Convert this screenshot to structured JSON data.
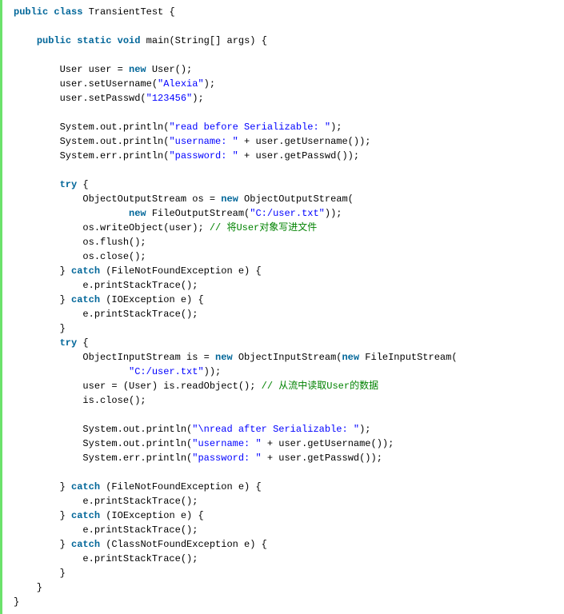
{
  "code": {
    "t01": "public",
    "t02": "class",
    "t03": " TransientTest {",
    "blank": "",
    "t04": "public",
    "t05": "static",
    "t06": "void",
    "t07": " main(String[] args) {",
    "t08": "        User user = ",
    "t09": "new",
    "t10": " User();",
    "t11": "        user.setUsername(",
    "t12": "\"Alexia\"",
    "t13": ");",
    "t14": "        user.setPasswd(",
    "t15": "\"123456\"",
    "t16": ");",
    "t17": "        System.out.println(",
    "t18": "\"read before Serializable: \"",
    "t19": ");",
    "t20": "        System.out.println(",
    "t21": "\"username: \"",
    "t22": " + user.getUsername());",
    "t23": "        System.err.println(",
    "t24": "\"password: \"",
    "t25": " + user.getPasswd());",
    "t26": "try",
    "t27": " {",
    "t28": "            ObjectOutputStream os = ",
    "t29": "new",
    "t30": " ObjectOutputStream(",
    "t31": "                    ",
    "t32": "new",
    "t33": " FileOutputStream(",
    "t34": "\"C:/user.txt\"",
    "t35": "));",
    "t36": "            os.writeObject(user); ",
    "t37": "// 将User对象写进文件",
    "t38": "            os.flush();",
    "t39": "            os.close();",
    "t40": "        } ",
    "t41": "catch",
    "t42": " (FileNotFoundException e) {",
    "t43": "            e.printStackTrace();",
    "t44": "        } ",
    "t45": "catch",
    "t46": " (IOException e) {",
    "t47": "            e.printStackTrace();",
    "t48": "        }",
    "t49": "try",
    "t50": " {",
    "t51": "            ObjectInputStream is = ",
    "t52": "new",
    "t53": " ObjectInputStream(",
    "t54": "new",
    "t55": " FileInputStream(",
    "t56": "                    ",
    "t57": "\"C:/user.txt\"",
    "t58": "));",
    "t59": "            user = (User) is.readObject(); ",
    "t60": "// 从流中读取User的数据",
    "t61": "            is.close();",
    "t62": "            System.out.println(",
    "t63": "\"\\nread after Serializable: \"",
    "t64": ");",
    "t65": "            System.out.println(",
    "t66": "\"username: \"",
    "t67": " + user.getUsername());",
    "t68": "            System.err.println(",
    "t69": "\"password: \"",
    "t70": " + user.getPasswd());",
    "t71": "        } ",
    "t72": "catch",
    "t73": " (FileNotFoundException e) {",
    "t74": "            e.printStackTrace();",
    "t75": "        } ",
    "t76": "catch",
    "t77": " (IOException e) {",
    "t78": "            e.printStackTrace();",
    "t79": "        } ",
    "t80": "catch",
    "t81": " (ClassNotFoundException e) {",
    "t82": "            e.printStackTrace();",
    "t83": "        }",
    "t84": "    }",
    "t85": "}"
  }
}
